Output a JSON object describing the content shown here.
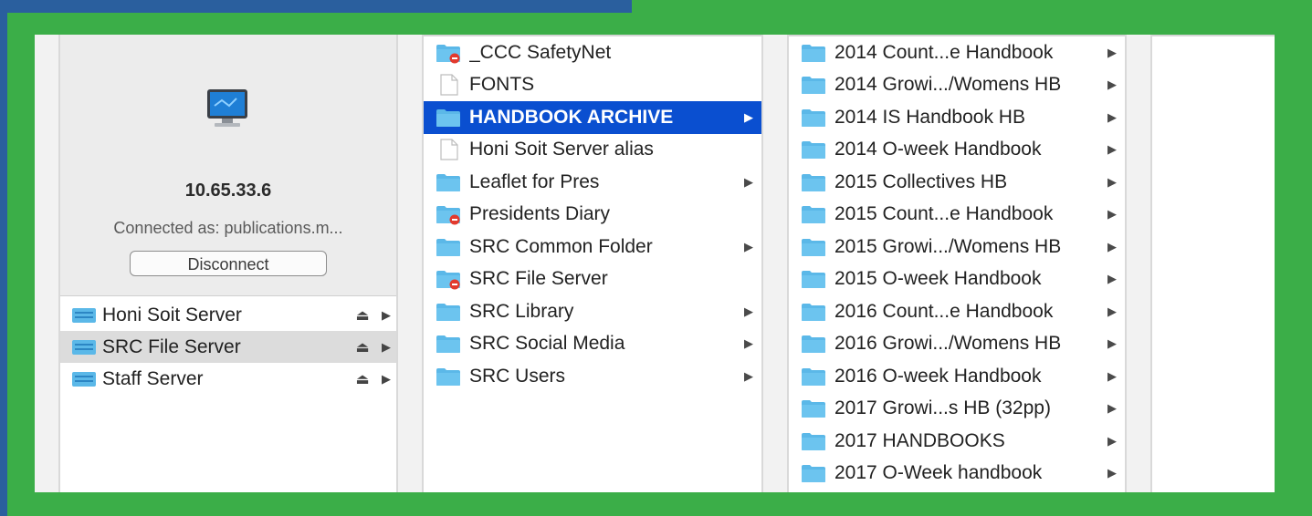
{
  "server": {
    "ip": "10.65.33.6",
    "connected_as": "Connected as: publications.m...",
    "disconnect_label": "Disconnect",
    "servers": [
      {
        "name": "Honi Soit Server",
        "selected": false
      },
      {
        "name": "SRC File Server",
        "selected": true
      },
      {
        "name": "Staff Server",
        "selected": false
      }
    ]
  },
  "column2": {
    "items": [
      {
        "label": "_CCC SafetyNet",
        "icon": "folder-restricted-icon",
        "arrow": false,
        "selected": false
      },
      {
        "label": "FONTS",
        "icon": "document-icon",
        "arrow": false,
        "selected": false
      },
      {
        "label": "HANDBOOK ARCHIVE",
        "icon": "folder-icon",
        "arrow": true,
        "selected": true
      },
      {
        "label": "Honi Soit Server alias",
        "icon": "document-icon",
        "arrow": false,
        "selected": false
      },
      {
        "label": "Leaflet for Pres",
        "icon": "folder-icon",
        "arrow": true,
        "selected": false
      },
      {
        "label": "Presidents Diary",
        "icon": "folder-restricted-icon",
        "arrow": false,
        "selected": false
      },
      {
        "label": "SRC Common Folder",
        "icon": "folder-icon",
        "arrow": true,
        "selected": false
      },
      {
        "label": "SRC File Server",
        "icon": "folder-restricted-icon",
        "arrow": false,
        "selected": false
      },
      {
        "label": "SRC Library",
        "icon": "folder-icon",
        "arrow": true,
        "selected": false
      },
      {
        "label": "SRC Social Media",
        "icon": "folder-icon",
        "arrow": true,
        "selected": false
      },
      {
        "label": "SRC Users",
        "icon": "folder-icon",
        "arrow": true,
        "selected": false
      }
    ]
  },
  "column3": {
    "items": [
      {
        "label": "2014 Count...e Handbook",
        "arrow": true
      },
      {
        "label": "2014 Growi.../Womens HB",
        "arrow": true
      },
      {
        "label": "2014 IS Handbook HB",
        "arrow": true
      },
      {
        "label": "2014 O-week Handbook",
        "arrow": true
      },
      {
        "label": "2015 Collectives HB",
        "arrow": true
      },
      {
        "label": "2015 Count...e Handbook",
        "arrow": true
      },
      {
        "label": "2015 Growi.../Womens HB",
        "arrow": true
      },
      {
        "label": "2015 O-week Handbook",
        "arrow": true
      },
      {
        "label": "2016 Count...e Handbook",
        "arrow": true
      },
      {
        "label": "2016 Growi.../Womens HB",
        "arrow": true
      },
      {
        "label": "2016 O-week Handbook",
        "arrow": true
      },
      {
        "label": "2017 Growi...s HB (32pp)",
        "arrow": true
      },
      {
        "label": "2017 HANDBOOKS",
        "arrow": true
      },
      {
        "label": "2017 O-Week handbook",
        "arrow": true
      }
    ]
  },
  "colors": {
    "background": "#3bae48",
    "selection": "#0a4fd0",
    "folder": "#5bb8e8"
  },
  "glyphs": {
    "eject": "⏏",
    "arrow": "▶"
  }
}
